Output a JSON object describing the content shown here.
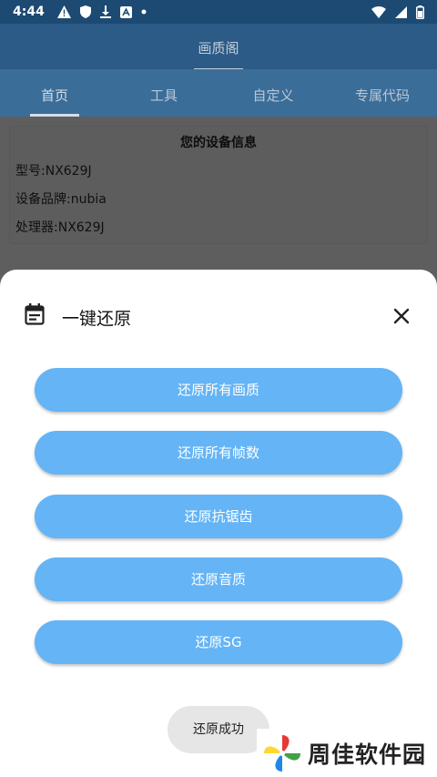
{
  "status_bar": {
    "time": "4:44",
    "icons": [
      "warning-icon",
      "shield-icon",
      "download-icon",
      "app-a-icon",
      "dot-icon",
      "wifi-icon",
      "signal-icon",
      "battery-icon"
    ]
  },
  "app_bar": {
    "title": "画质阁"
  },
  "tabs": [
    {
      "label": "首页",
      "active": true
    },
    {
      "label": "工具",
      "active": false
    },
    {
      "label": "自定义",
      "active": false
    },
    {
      "label": "专属代码",
      "active": false
    }
  ],
  "device_info": {
    "title": "您的设备信息",
    "model": "型号:NX629J",
    "brand": "设备品牌:nubia",
    "processor": "处理器:NX629J"
  },
  "sheet": {
    "title": "一键还原",
    "buttons": [
      {
        "label": "还原所有画质"
      },
      {
        "label": "还原所有帧数"
      },
      {
        "label": "还原抗锯齿"
      },
      {
        "label": "还原音质"
      },
      {
        "label": "还原SG"
      }
    ]
  },
  "toast": "还原成功",
  "watermark": {
    "text": "周佳软件园"
  },
  "colors": {
    "accent": "#64b4f6",
    "status_bar": "#1c4a73",
    "app_bar": "#2b5b86",
    "tabs": "#3b6d99",
    "scrim": "#5e5e5e"
  }
}
